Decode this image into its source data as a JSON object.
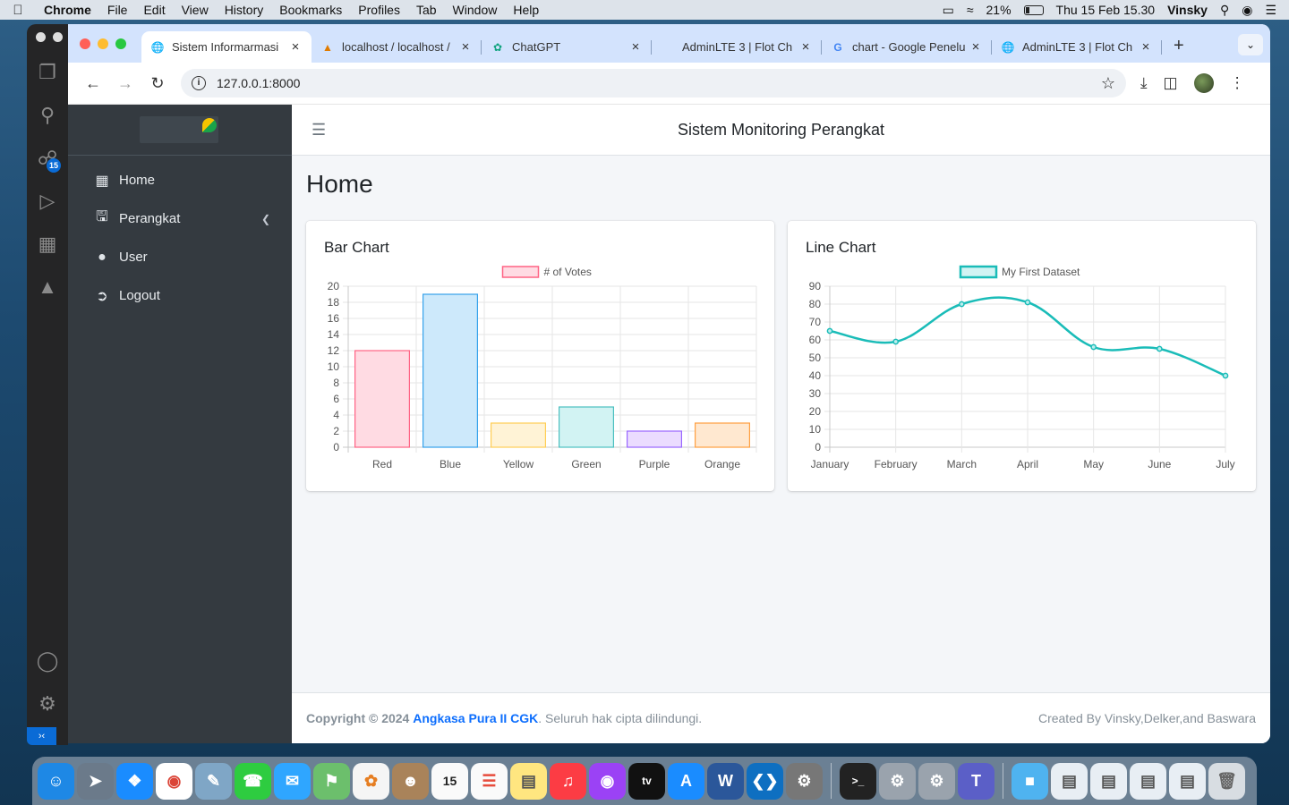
{
  "menubar": {
    "app": "Chrome",
    "items": [
      "File",
      "Edit",
      "View",
      "History",
      "Bookmarks",
      "Profiles",
      "Tab",
      "Window",
      "Help"
    ],
    "battery": "21%",
    "datetime": "Thu 15 Feb  15.30",
    "user": "Vinsky"
  },
  "vscode": {
    "badge": "15"
  },
  "tabs": [
    {
      "label": "Sistem Informarmasi",
      "icon": "globe-icon"
    },
    {
      "label": "localhost / localhost /",
      "icon": "phpmyadmin-icon"
    },
    {
      "label": "ChatGPT",
      "icon": "chatgpt-icon"
    },
    {
      "label": "AdminLTE 3 | Flot Ch",
      "icon": "blank-icon"
    },
    {
      "label": "chart - Google Penelu",
      "icon": "google-icon"
    },
    {
      "label": "AdminLTE 3 | Flot Ch",
      "icon": "globe-icon"
    }
  ],
  "address": {
    "url": "127.0.0.1:8000"
  },
  "sidebar": {
    "items": [
      {
        "label": "Home",
        "icon": "grid-icon"
      },
      {
        "label": "Perangkat",
        "icon": "monitor-icon"
      },
      {
        "label": "User",
        "icon": "user-icon"
      },
      {
        "label": "Logout",
        "icon": "logout-icon"
      }
    ]
  },
  "header": {
    "title": "Sistem Monitoring Perangkat"
  },
  "page": {
    "title": "Home"
  },
  "footer": {
    "copyright": "Copyright © 2024",
    "brand": "Angkasa Pura II CGK",
    "rights": ". Seluruh hak cipta dilindungi.",
    "credit": "Created By Vinsky,Delker,and Baswara"
  },
  "colors": {
    "sidebar": "#343a40",
    "link": "#0d6efd",
    "line": "#1abcb8"
  },
  "chart_data": [
    {
      "type": "bar",
      "title": "Bar Chart",
      "categories": [
        "Red",
        "Blue",
        "Yellow",
        "Green",
        "Purple",
        "Orange"
      ],
      "series": [
        {
          "name": "# of Votes",
          "values": [
            12,
            19,
            3,
            5,
            2,
            3
          ]
        }
      ],
      "ylim": [
        0,
        20
      ],
      "yticks": [
        0,
        2,
        4,
        6,
        8,
        10,
        12,
        14,
        16,
        18,
        20
      ],
      "grid": true,
      "legend": "top",
      "colors": [
        {
          "fill": "#ffdbe3",
          "stroke": "#ff6384"
        },
        {
          "fill": "#cde9fb",
          "stroke": "#36a2eb"
        },
        {
          "fill": "#fff3d6",
          "stroke": "#ffce56"
        },
        {
          "fill": "#d2f3f3",
          "stroke": "#4bc0c0"
        },
        {
          "fill": "#ebdcff",
          "stroke": "#9966ff"
        },
        {
          "fill": "#ffe8d0",
          "stroke": "#ff9f40"
        }
      ]
    },
    {
      "type": "line",
      "title": "Line Chart",
      "x": [
        "January",
        "February",
        "March",
        "April",
        "May",
        "June",
        "July"
      ],
      "series": [
        {
          "name": "My First Dataset",
          "values": [
            65,
            59,
            80,
            81,
            56,
            55,
            40
          ]
        }
      ],
      "ylim": [
        0,
        90
      ],
      "yticks": [
        0,
        10,
        20,
        30,
        40,
        50,
        60,
        70,
        80,
        90
      ],
      "grid": true,
      "legend": "top",
      "color": "#1abcb8"
    }
  ]
}
